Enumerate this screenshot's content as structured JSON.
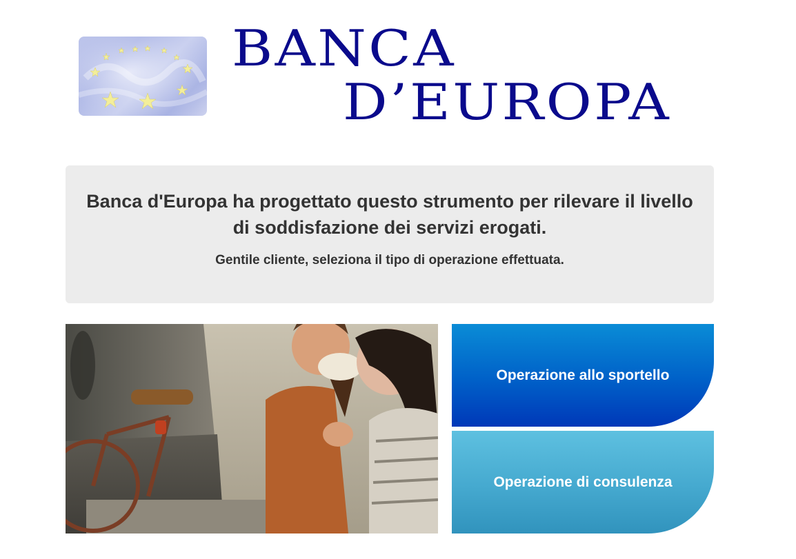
{
  "header": {
    "logo_icon": "eu-stars-logo",
    "brand_line1": "BANCA",
    "brand_line2": "D’EUROPA",
    "brand_color": "#0a0a8c"
  },
  "intro": {
    "heading": "Banca d'Europa ha progettato questo strumento per rilevare il livello di soddisfazione dei servizi erogati.",
    "subheading": "Gentile cliente, seleziona il tipo di operazione effettuata."
  },
  "photo": {
    "icon": "photo-children-ice-cream"
  },
  "options": {
    "sportello_label": "Operazione allo sportello",
    "consulenza_label": "Operazione di consulenza",
    "sportello_color": "#0060c8",
    "consulenza_color": "#45a9cf"
  }
}
